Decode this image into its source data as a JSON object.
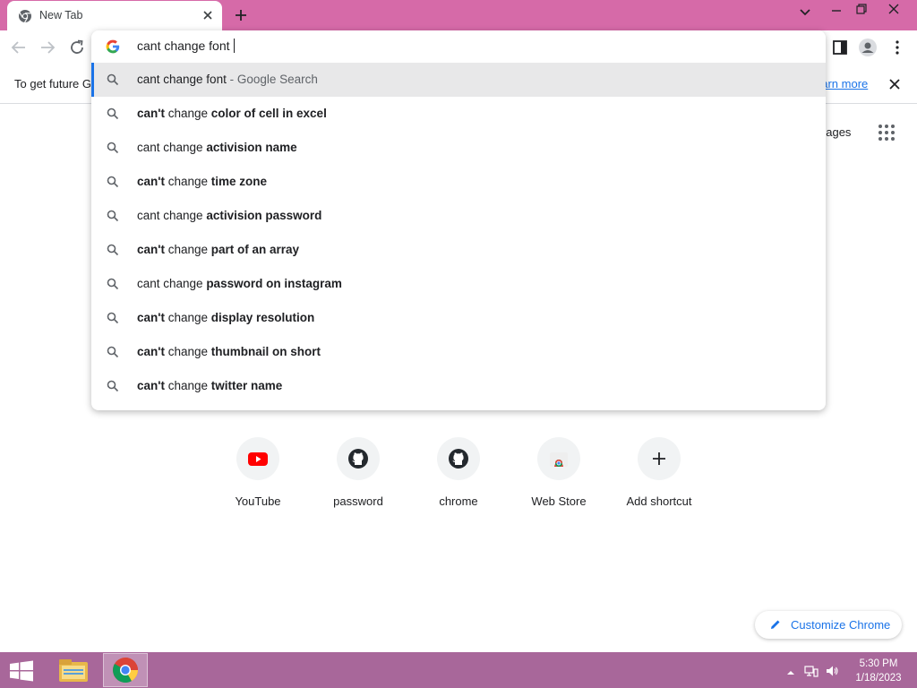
{
  "browser": {
    "tab_title": "New Tab",
    "omnibox_text": "cant change font"
  },
  "infobar": {
    "text": "To get future G",
    "link_text": "earn more"
  },
  "page": {
    "images_link": "nages"
  },
  "suggestions": [
    {
      "parts": [
        {
          "t": "cant change font",
          "b": false
        }
      ],
      "suffix": " - Google Search"
    },
    {
      "parts": [
        {
          "t": "can't",
          "b": true
        },
        {
          "t": " change ",
          "b": false
        },
        {
          "t": "color of cell in excel",
          "b": true
        }
      ]
    },
    {
      "parts": [
        {
          "t": "cant change ",
          "b": false
        },
        {
          "t": "activision name",
          "b": true
        }
      ]
    },
    {
      "parts": [
        {
          "t": "can't",
          "b": true
        },
        {
          "t": " change ",
          "b": false
        },
        {
          "t": "time zone",
          "b": true
        }
      ]
    },
    {
      "parts": [
        {
          "t": "cant change ",
          "b": false
        },
        {
          "t": "activision password",
          "b": true
        }
      ]
    },
    {
      "parts": [
        {
          "t": "can't",
          "b": true
        },
        {
          "t": " change ",
          "b": false
        },
        {
          "t": "part of an array",
          "b": true
        }
      ]
    },
    {
      "parts": [
        {
          "t": "cant change ",
          "b": false
        },
        {
          "t": "password on instagram",
          "b": true
        }
      ]
    },
    {
      "parts": [
        {
          "t": "can't",
          "b": true
        },
        {
          "t": " change ",
          "b": false
        },
        {
          "t": "display resolution",
          "b": true
        }
      ]
    },
    {
      "parts": [
        {
          "t": "can't",
          "b": true
        },
        {
          "t": " change ",
          "b": false
        },
        {
          "t": "thumbnail on short",
          "b": true
        }
      ]
    },
    {
      "parts": [
        {
          "t": "can't",
          "b": true
        },
        {
          "t": " change ",
          "b": false
        },
        {
          "t": "twitter name",
          "b": true
        }
      ]
    }
  ],
  "shortcuts": [
    {
      "label": "YouTube",
      "icon": "youtube-icon"
    },
    {
      "label": "password",
      "icon": "github-icon"
    },
    {
      "label": "chrome",
      "icon": "github-icon"
    },
    {
      "label": "Web Store",
      "icon": "chrome-web-store-icon"
    },
    {
      "label": "Add shortcut",
      "icon": "plus-icon"
    }
  ],
  "customize": {
    "label": "Customize Chrome"
  },
  "taskbar": {
    "time": "5:30 PM",
    "date": "1/18/2023"
  },
  "colors": {
    "titlebar": "#d66aa8",
    "taskbar": "#a8679a",
    "accent": "#1a73e8"
  }
}
